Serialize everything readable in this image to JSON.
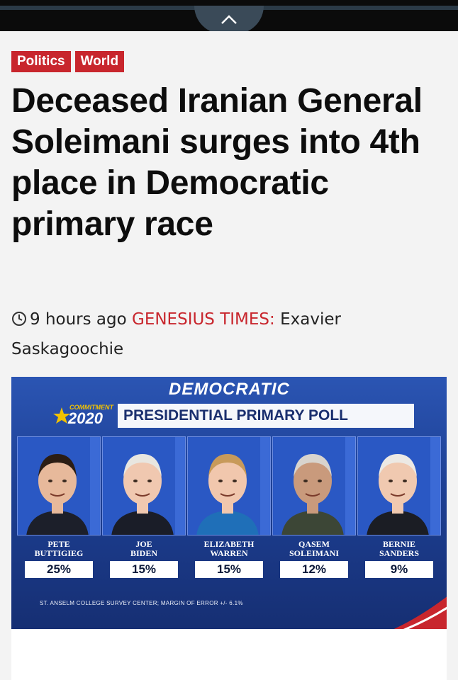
{
  "tags": [
    "Politics",
    "World"
  ],
  "headline": "Deceased Iranian General Soleimani surges into 4th place in Democratic primary race",
  "meta": {
    "time": "9 hours ago",
    "source": "GENESIUS TIMES:",
    "author": "Exavier Saskagoochie"
  },
  "poll_graphic": {
    "header": "DEMOCRATIC",
    "logo_small": "COMMITMENT",
    "logo_year": "2020",
    "title": "PRESIDENTIAL PRIMARY POLL",
    "footnote": "ST. ANSELM COLLEGE SURVEY CENTER; MARGIN OF ERROR +/- 6.1%",
    "colors": {
      "bg": "#1d3f93",
      "accent": "#c8262d",
      "gold": "#f2c200"
    }
  },
  "chart_data": {
    "type": "bar",
    "title": "PRESIDENTIAL PRIMARY POLL",
    "categories": [
      "PETE BUTTIGIEG",
      "JOE BIDEN",
      "ELIZABETH WARREN",
      "QASEM SOLEIMANI",
      "BERNIE SANDERS"
    ],
    "values": [
      25,
      15,
      15,
      12,
      9
    ],
    "value_labels": [
      "25%",
      "15%",
      "15%",
      "12%",
      "9%"
    ],
    "card_names": [
      [
        "PETE",
        "BUTTIGIEG"
      ],
      [
        "JOE",
        "BIDEN"
      ],
      [
        "ELIZABETH",
        "WARREN"
      ],
      [
        "QASEM",
        "SOLEIMANI"
      ],
      [
        "BERNIE",
        "SANDERS"
      ]
    ]
  }
}
